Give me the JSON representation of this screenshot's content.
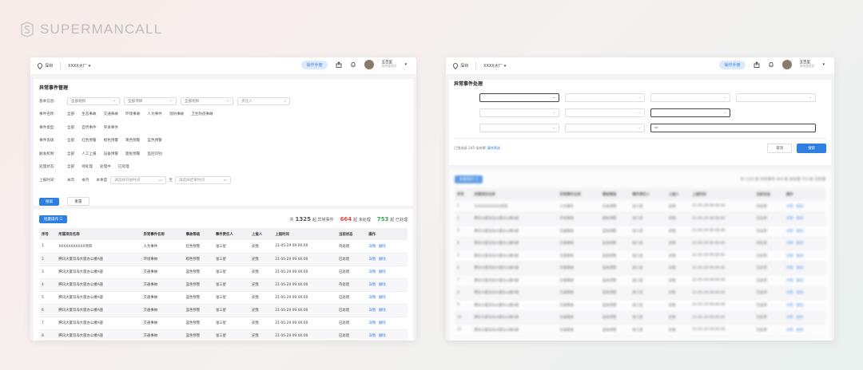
{
  "brand": {
    "name": "SUPERMANCALL"
  },
  "left": {
    "topbar": {
      "location": "深圳",
      "building": "XXXX大厂",
      "manual": "操作手册",
      "user": "五百里",
      "role": "系统管理员"
    },
    "title": "异常事件管理",
    "filters": [
      {
        "label": "基本信息:",
        "selects": [
          "全部组织",
          "全部项目",
          "全部组织"
        ],
        "input": "责任人"
      },
      {
        "label": "事件名称:",
        "options": [
          "全部",
          "生态事故",
          "交通事故",
          "环境事故",
          "人为事件",
          "消防事故",
          "卫生防疫事故"
        ]
      },
      {
        "label": "事件类型:",
        "options": [
          "全部",
          "自然事件",
          "突发事件"
        ]
      },
      {
        "label": "事件等级:",
        "options": [
          "全部",
          "红色预警",
          "橙色预警",
          "黄色预警",
          "蓝色预警"
        ]
      },
      {
        "label": "触发机制:",
        "options": [
          "全部",
          "人工上报",
          "设备预警",
          "面板预警",
          "监控识别"
        ]
      },
      {
        "label": "处理状态:",
        "options": [
          "全部",
          "待处理",
          "处理中",
          "已处理"
        ]
      },
      {
        "label": "上报时间:",
        "options": [
          "本年",
          "本月",
          "本季度"
        ],
        "start": "请选择开始时间",
        "mid": "至",
        "end": "请选择结束时间"
      }
    ],
    "search_btn": "搜索",
    "reset_btn": "重置",
    "batch": "批量操作",
    "stats": {
      "total_prefix": "共",
      "total": "1325",
      "total_suffix": "起 异常事件",
      "pending": "664",
      "pending_suffix": "起 未处理",
      "done": "753",
      "done_suffix": "起 已处理"
    },
    "columns": [
      "序号",
      "所属项目名称",
      "异常事件名称",
      "事故等级",
      "事件责任人",
      "上报人",
      "上报时间",
      "当前状态",
      "操作"
    ],
    "rows": [
      [
        "1",
        "XXXXXXXXXXX项目",
        "人为事件",
        "红色预警",
        "张三星",
        "史我",
        "21-05-29 09:00:00",
        "待处理"
      ],
      [
        "2",
        "腾讯大厦滨海大厦办公楼A座",
        "环境事故",
        "橙色预警",
        "张三星",
        "史我",
        "21-05-29 09:00:00",
        "已处理"
      ],
      [
        "3",
        "腾讯大厦滨海大厦办公楼A座",
        "交通事故",
        "蓝色预警",
        "张三星",
        "史我",
        "21-05-29 09:00:00",
        "已处理"
      ],
      [
        "4",
        "腾讯大厦滨海大厦办公楼A座",
        "交通事故",
        "蓝色预警",
        "张三星",
        "史我",
        "21-05-29 09:00:00",
        "待处理"
      ],
      [
        "5",
        "腾讯大厦滨海大厦办公楼A座",
        "交通事故",
        "蓝色预警",
        "张三星",
        "史我",
        "21-05-29 09:00:00",
        "已处理"
      ],
      [
        "6",
        "腾讯大厦滨海大厦办公楼A座",
        "交通事故",
        "蓝色预警",
        "张三星",
        "史我",
        "21-05-29 09:00:00",
        "已处理"
      ],
      [
        "7",
        "腾讯大厦滨海大厦办公楼A座",
        "交通事故",
        "蓝色预警",
        "张三星",
        "史我",
        "21-05-29 09:00:00",
        "已处理"
      ],
      [
        "8",
        "腾讯大厦滨海大厦办公楼A座",
        "交通事故",
        "蓝色预警",
        "张三星",
        "史我",
        "21-05-29 09:00:00",
        "已处理"
      ]
    ],
    "actions": {
      "detail": "详情",
      "delete": "删除"
    }
  },
  "right": {
    "topbar": {
      "location": "深圳",
      "building": "XXXX大厂",
      "manual": "操作手册",
      "user": "五百里",
      "role": "系统管理员"
    },
    "title": "异常事件处理",
    "rows": [
      [
        "1",
        "XXXXXXXXXXX项目",
        "人为事件",
        "红色预警",
        "张三星",
        "史我",
        "21-05-29 09:00:00",
        "待处理"
      ],
      [
        "2",
        "腾讯大厦滨海大厦办公楼A座",
        "环境事故",
        "橙色预警",
        "张三星",
        "史我",
        "21-05-29 09:00:00",
        "已处理"
      ],
      [
        "3",
        "腾讯大厦滨海大厦办公楼A座",
        "交通事故",
        "蓝色预警",
        "张三星",
        "史我",
        "21-05-29 09:00:00",
        "已处理"
      ],
      [
        "4",
        "腾讯大厦滨海大厦办公楼A座",
        "交通事故",
        "蓝色预警",
        "张三星",
        "史我",
        "21-05-29 09:00:00",
        "待处理"
      ],
      [
        "5",
        "腾讯大厦滨海大厦办公楼A座",
        "交通事故",
        "蓝色预警",
        "张三星",
        "史我",
        "21-05-29 09:00:00",
        "已处理"
      ],
      [
        "6",
        "腾讯大厦滨海大厦办公楼A座",
        "交通事故",
        "蓝色预警",
        "张三星",
        "史我",
        "21-05-29 09:00:00",
        "已处理"
      ],
      [
        "7",
        "腾讯大厦滨海大厦办公楼A座",
        "交通事故",
        "蓝色预警",
        "张三星",
        "史我",
        "21-05-29 09:00:00",
        "已处理"
      ],
      [
        "8",
        "腾讯大厦滨海大厦办公楼A座",
        "交通事故",
        "蓝色预警",
        "张三星",
        "史我",
        "21-05-29 09:00:00",
        "已处理"
      ],
      [
        "9",
        "腾讯大厦滨海大厦办公楼A座",
        "交通事故",
        "蓝色预警",
        "张三星",
        "史我",
        "21-05-29 09:00:00",
        "已处理"
      ],
      [
        "10",
        "腾讯大厦滨海大厦办公楼A座",
        "交通事故",
        "蓝色预警",
        "张三星",
        "史我",
        "21-05-29 09:00:00",
        "已处理"
      ],
      [
        "11",
        "腾讯大厦滨海大厦办公楼A座",
        "交通事故",
        "蓝色预警",
        "张三星",
        "史我",
        "21-05-29 09:00:00",
        "已处理"
      ]
    ],
    "selected_text": "已筛选条 245 条结果",
    "clear": "清除筛选",
    "cancel": "取消",
    "search": "搜索",
    "batch": "批量操作",
    "stats": "共 1325 起 异常事件  664 起 未处理  753 起 已处理",
    "columns": [
      "序号",
      "所属项目名称",
      "异常事件名称",
      "事故等级",
      "事件责任人",
      "上报人",
      "上报时间",
      "当前状态",
      "操作"
    ],
    "actions": {
      "detail": "详情",
      "delete": "删除"
    }
  }
}
